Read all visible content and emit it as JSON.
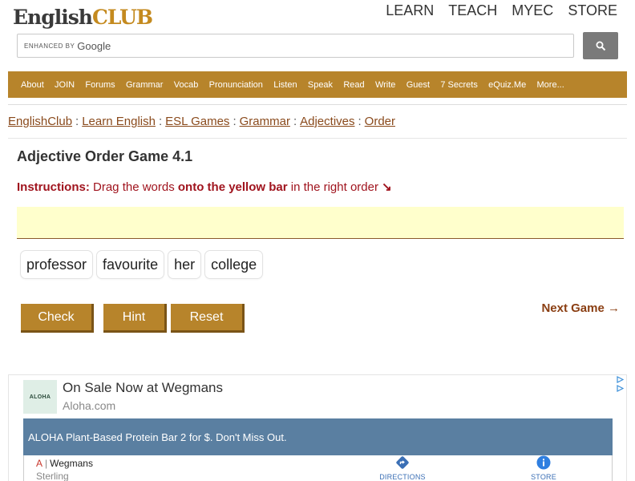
{
  "header": {
    "logo": {
      "part1": "English",
      "part2": "CLUB"
    },
    "nav": [
      "LEARN",
      "TEACH",
      "MYEC",
      "STORE"
    ]
  },
  "search": {
    "enhanced_by": "ENHANCED BY",
    "provider": "Google"
  },
  "navbar": [
    "About",
    "JOIN",
    "Forums",
    "Grammar",
    "Vocab",
    "Pronunciation",
    "Listen",
    "Speak",
    "Read",
    "Write",
    "Guest",
    "7 Secrets",
    "eQuiz.Me",
    "More..."
  ],
  "breadcrumb": [
    "EnglishClub",
    "Learn English",
    "ESL Games",
    "Grammar",
    "Adjectives",
    "Order"
  ],
  "breadcrumb_separator": ":",
  "game": {
    "title": "Adjective Order Game 4.1",
    "instructions_label": "Instructions:",
    "instructions_text1": " Drag the words ",
    "instructions_bold": "onto the yellow bar",
    "instructions_text2": " in the right order ",
    "instructions_arrow": "↘",
    "words": [
      "professor",
      "favourite",
      "her",
      "college"
    ],
    "buttons": {
      "check": "Check",
      "hint": "Hint",
      "reset": "Reset"
    },
    "next": "Next Game →"
  },
  "ad": {
    "logo_text": "ALOHA",
    "headline": "On Sale Now at Wegmans",
    "domain": "Aloha.com",
    "banner": "ALOHA Plant-Based Protein Bar 2 for $. Don't Miss Out.",
    "location_marker": "A",
    "location_name": "Wegmans",
    "city": "Sterling",
    "directions": "DIRECTIONS",
    "store": "STORE"
  },
  "colors": {
    "brown": "#b7842b",
    "link": "#8a4a1c",
    "instructions": "#a0141e",
    "yellow_bar": "#ffffcc",
    "ad_banner": "#5a7fa1"
  }
}
